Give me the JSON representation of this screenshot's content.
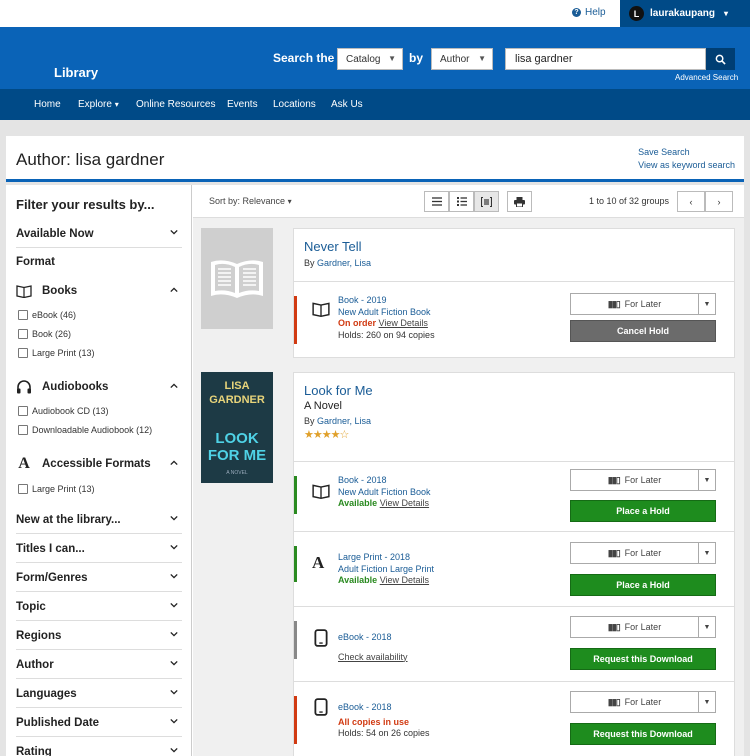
{
  "topbar": {
    "help_label": "Help",
    "avatar_initial": "L",
    "username": "laurakaupang"
  },
  "header": {
    "logo": "Library",
    "search_the": "Search the",
    "catalog_select": "Catalog",
    "by": "by",
    "field_select": "Author",
    "query": "lisa gardner",
    "advanced": "Advanced Search"
  },
  "nav": [
    "Home",
    "Explore",
    "Online Resources",
    "Events",
    "Locations",
    "Ask Us"
  ],
  "page": {
    "title": "Author: lisa gardner",
    "save_search": "Save Search",
    "keyword_search": "View as keyword search"
  },
  "filters": {
    "heading": "Filter your results by...",
    "available_now": "Available Now",
    "format": "Format",
    "books": {
      "label": "Books",
      "items": [
        "eBook (46)",
        "Book (26)",
        "Large Print (13)"
      ]
    },
    "audiobooks": {
      "label": "Audiobooks",
      "items": [
        "Audiobook CD (13)",
        "Downloadable Audiobook (12)"
      ]
    },
    "accessible": {
      "label": "Accessible Formats",
      "items": [
        "Large Print (13)"
      ]
    },
    "groups": [
      "New at the library...",
      "Titles I can...",
      "Form/Genres",
      "Topic",
      "Regions",
      "Author",
      "Languages",
      "Published Date",
      "Rating"
    ]
  },
  "toolbar": {
    "sort": "Sort by: Relevance",
    "range": "1 to 10 of 32 groups"
  },
  "results": [
    {
      "title": "Never Tell",
      "subtitle": "",
      "by": "By",
      "author": "Gardner, Lisa",
      "formats": [
        {
          "type": "Book - 2019",
          "collection": "New Adult Fiction Book",
          "status": "On order",
          "details": "View Details",
          "holds": "Holds: 260 on 94 copies",
          "later": "For Later",
          "action": "Cancel Hold"
        }
      ]
    },
    {
      "title": "Look for Me",
      "subtitle": "A Novel",
      "by": "By",
      "author": "Gardner, Lisa",
      "rating": 4.5,
      "cover": {
        "author": "LISA GARDNER",
        "title": "LOOK FOR ME",
        "tag": "A NOVEL"
      },
      "formats": [
        {
          "type": "Book - 2018",
          "collection": "New Adult Fiction Book",
          "status": "Available",
          "details": "View Details",
          "later": "For Later",
          "action": "Place a Hold"
        },
        {
          "type": "Large Print - 2018",
          "collection": "Adult Fiction Large Print",
          "status": "Available",
          "details": "View Details",
          "later": "For Later",
          "action": "Place a Hold"
        },
        {
          "type": "eBook - 2018",
          "check": "Check availability",
          "later": "For Later",
          "action": "Request this Download"
        },
        {
          "type": "eBook - 2018",
          "status": "All copies in use",
          "holds": "Holds: 54 on 26 copies",
          "later": "For Later",
          "action": "Request this Download"
        }
      ]
    }
  ],
  "colors": {
    "brand": "#0a63b7",
    "nav": "#004a87",
    "available": "#2a8a20",
    "unavailable": "#d13a12",
    "hold_button": "#1e8c1e"
  }
}
